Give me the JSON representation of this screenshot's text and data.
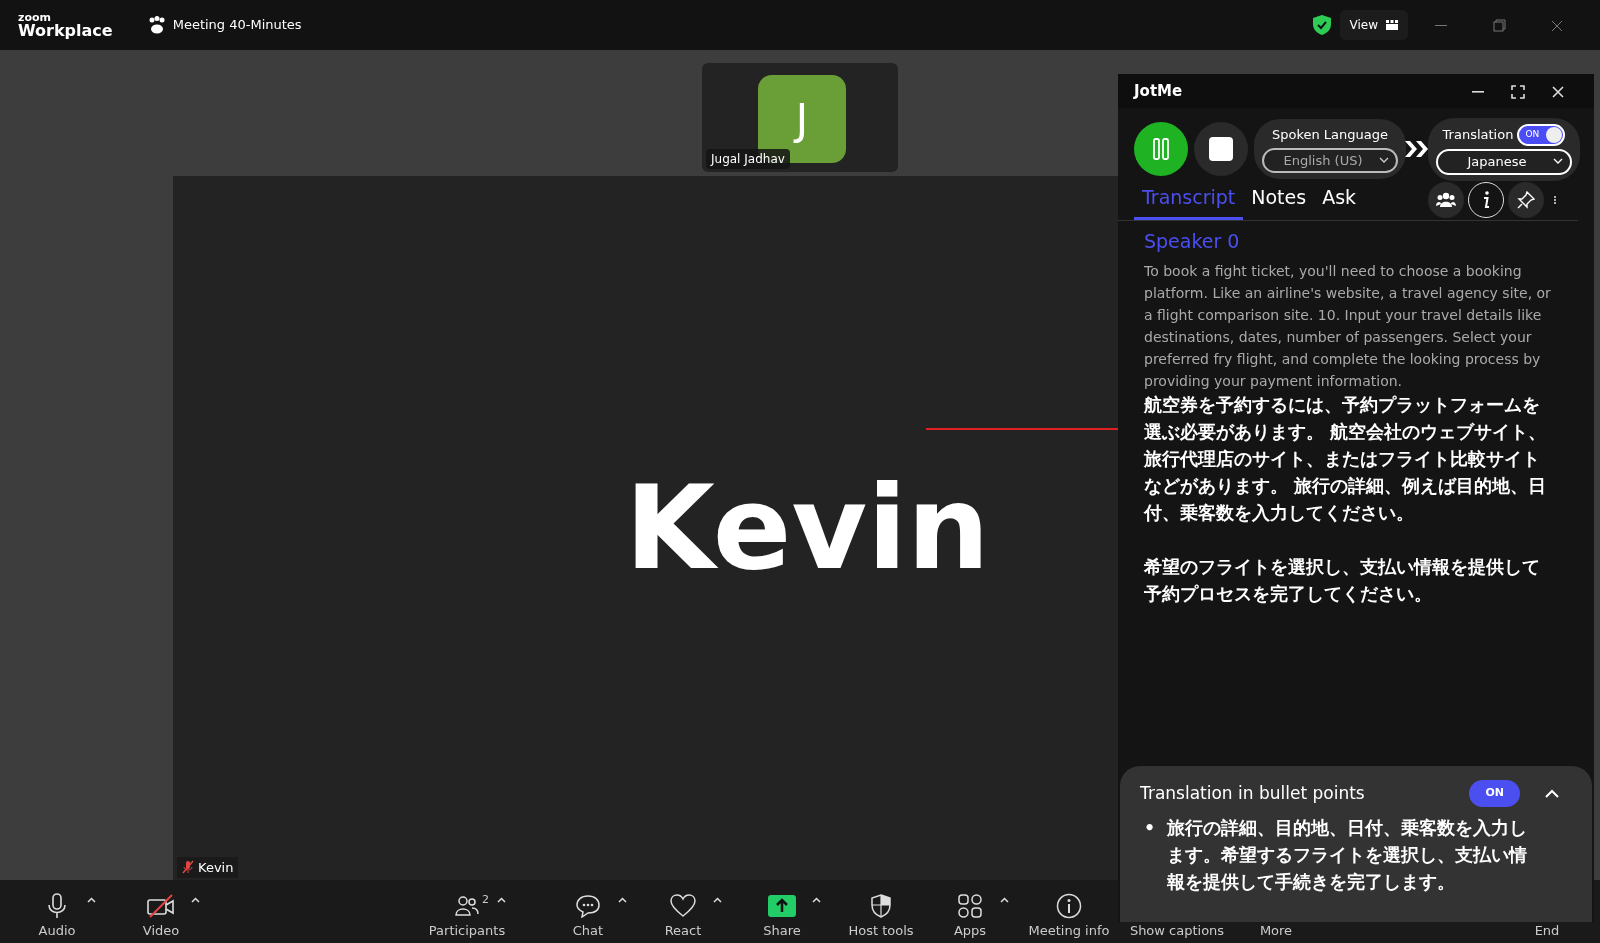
{
  "titlebar": {
    "logo_top": "zoom",
    "logo_bottom": "Workplace",
    "meeting_title": "Meeting 40-Minutes",
    "view_button": "View"
  },
  "thumbnail": {
    "initial": "J",
    "name": "Jugal Jadhav"
  },
  "main_video": {
    "big_name": "Kevin",
    "name_label": "Kevin",
    "muted": true
  },
  "jotme": {
    "title": "JotMe",
    "spoken_language": {
      "label": "Spoken Language",
      "value": "English (US)"
    },
    "translation": {
      "label": "Translation",
      "on": true,
      "toggle_text": "ON",
      "value": "Japanese"
    },
    "tabs": [
      {
        "label": "Transcript",
        "selected": true
      },
      {
        "label": "Notes",
        "selected": false
      },
      {
        "label": "Ask",
        "selected": false
      }
    ],
    "transcript": {
      "speaker": "Speaker 0",
      "text": "To book a fight ticket, you'll need to choose a booking platform. Like an airline's website, a travel agency site, or a flight comparison site. 10. Input your travel details like destinations, dates, number of passengers. Select your preferred fry flight, and complete the looking process by providing your payment information.",
      "translation": [
        "航空券を予約するには、予約プラットフォームを選ぶ必要があります。 航空会社のウェブサイト、旅行代理店のサイト、またはフライト比較サイトなどがあります。 旅行の詳細、例えば目的地、日付、乗客数を入力してください。",
        "希望のフライトを選択し、支払い情報を提供して予約プロセスを完了してください。"
      ]
    },
    "bullet_panel": {
      "title": "Translation in bullet points",
      "toggle_text": "ON",
      "on": true,
      "expanded": true,
      "bullets": [
        {
          "marker": "•",
          "text": "旅行の詳細、目的地、日付、乗客数を入力します。希望するフライトを選択し、支払い情報を提供して手続きを完了します。"
        }
      ]
    }
  },
  "toolbar": [
    {
      "label": "Audio",
      "kind": "mic",
      "caret": true
    },
    {
      "label": "Video",
      "kind": "video-off",
      "caret": true
    },
    {
      "label": "Participants",
      "kind": "people",
      "count": "2",
      "caret": true
    },
    {
      "label": "Chat",
      "kind": "chat",
      "caret": true
    },
    {
      "label": "React",
      "kind": "heart",
      "caret": true
    },
    {
      "label": "Share",
      "kind": "share",
      "caret": true
    },
    {
      "label": "Host tools",
      "kind": "shield",
      "caret": false
    },
    {
      "label": "Apps",
      "kind": "apps",
      "caret": true
    },
    {
      "label": "Meeting info",
      "kind": "info",
      "caret": false
    },
    {
      "label": "Show captions",
      "kind": "captions",
      "caret": false
    },
    {
      "label": "More",
      "kind": "more",
      "caret": false
    },
    {
      "label": "End",
      "kind": "end",
      "caret": false
    }
  ]
}
